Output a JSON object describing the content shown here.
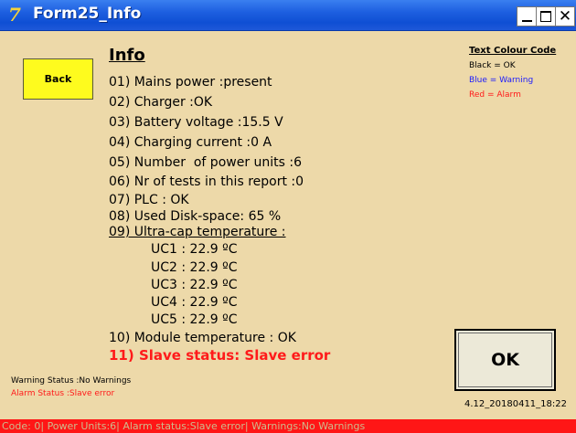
{
  "window": {
    "title": "Form25_Info",
    "app_icon": "7"
  },
  "titlebar_buttons": {
    "close_glyph": "✕"
  },
  "back_button": {
    "label": "Back"
  },
  "info": {
    "heading": "Info",
    "lines": [
      "01) Mains power :present",
      "02) Charger :OK",
      "03) Battery voltage :15.5 V",
      "04) Charging current :0 A",
      "05) Number  of power units :6",
      "06) Nr of tests in this report :0",
      "07) PLC : OK",
      "08) Used Disk-space: 65 %",
      "09) Ultra-cap temperature :"
    ],
    "uc_lines": [
      "UC1 : 22.9 ºC",
      "UC2 : 22.9 ºC",
      "UC3 : 22.9 ºC",
      "UC4 : 22.9 ºC",
      "UC5 : 22.9 ºC"
    ],
    "module_temp": "10) Module temperature : OK",
    "slave_status": "11) Slave status: Slave error"
  },
  "legend": {
    "title": "Text Colour Code",
    "items": [
      {
        "text": "Black = OK",
        "color": "#000000"
      },
      {
        "text": "Blue = Warning",
        "color": "#1a1aff"
      },
      {
        "text": "Red = Alarm",
        "color": "#ff1a1a"
      }
    ]
  },
  "ok_button": {
    "label": "OK"
  },
  "status": {
    "warning": "Warning Status :No Warnings",
    "alarm": "Alarm Status :Slave error"
  },
  "version": "4.12_20180411_18:22",
  "statusbar": {
    "text": "Code: 0| Power Units:6| Alarm status:Slave error| Warnings:No Warnings"
  }
}
